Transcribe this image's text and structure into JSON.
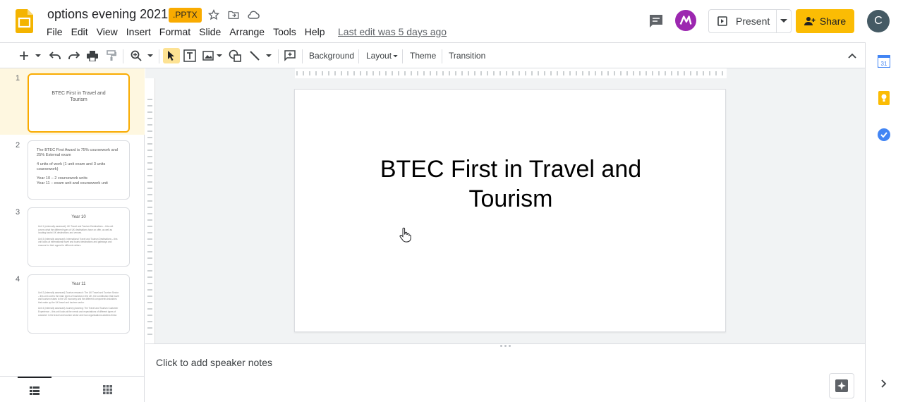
{
  "document": {
    "title": "options evening 2021",
    "format_badge": ".PPTX",
    "last_edit": "Last edit was 5 days ago"
  },
  "menu": [
    "File",
    "Edit",
    "View",
    "Insert",
    "Format",
    "Slide",
    "Arrange",
    "Tools",
    "Help"
  ],
  "header": {
    "present_label": "Present",
    "share_label": "Share",
    "avatar_initial": "C"
  },
  "toolbar": {
    "background_label": "Background",
    "layout_label": "Layout",
    "theme_label": "Theme",
    "transition_label": "Transition"
  },
  "slides": [
    {
      "number": "1",
      "title": "BTEC First in Travel and Tourism"
    },
    {
      "number": "2",
      "lines": [
        "The BTEC First Award is 75% coursework and 25% External exam",
        "4 units of work (1 unit exam and 3 units coursework)",
        "Year 10 – 2 coursework units",
        "Year 11 – exam unit and coursework unit"
      ]
    },
    {
      "number": "3",
      "title": "Year 10",
      "bullets": [
        "Unit 1 (externally assessed): UK Travel and Tourism Destinations – this unit covers what the different types of UK destinations have on offer, as well as locating tourist UK destinations and venues.",
        "Unit 3 (internally assessed): International Travel and Tourism Destinations – this unit looks at international travel and tourist destinations and gateways and reasons for their appeal to different visitors."
      ]
    },
    {
      "number": "4",
      "title": "Year 11",
      "bullets": [
        "Unit 2 (internally assessed) Tourism research: The UK Travel and Tourism Sector – this unit covers the main types of business in the UK, the contribution that travel and tourism makes to the UK economy and the different components industries that make up the UK travel and tourism sector.",
        "Unit 4 (internally assessed) Journey planning: The Travel and Tourism Customer Experience – this unit looks at the needs and expectations of different types of customer in the travel and tourism sector and how organisations address these."
      ]
    }
  ],
  "current_slide": {
    "title": "BTEC First in Travel and Tourism"
  },
  "notes": {
    "placeholder": "Click to add speaker notes"
  },
  "colors": {
    "brand_yellow": "#f9ab00",
    "share_yellow": "#fbbc04",
    "avatar_bg": "#455a64",
    "extension_purple": "#9c27b0"
  }
}
